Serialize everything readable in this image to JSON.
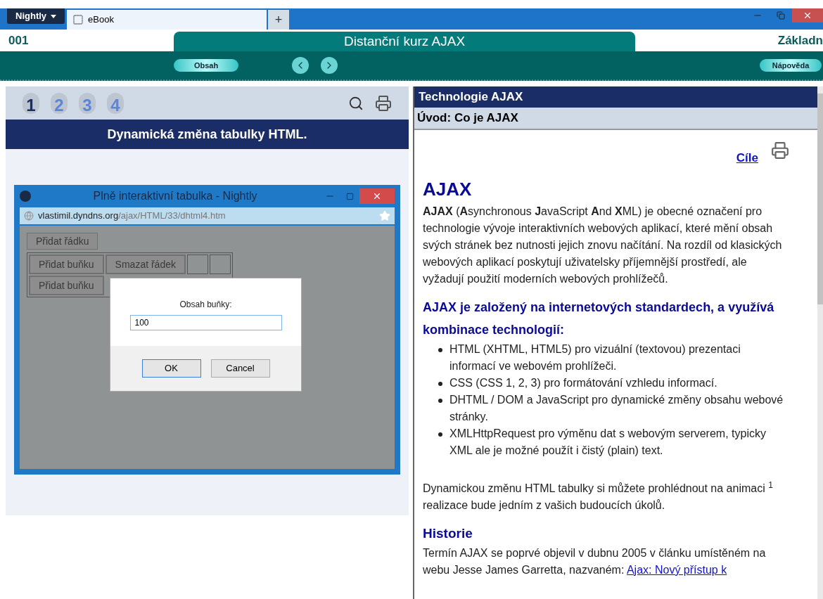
{
  "browser": {
    "menu_button": "Nightly",
    "tabs": [
      {
        "label": "eBook",
        "selected": true
      }
    ],
    "new_tab": "+"
  },
  "header": {
    "page_code": "001",
    "course_title": "Distanční kurz AJAX",
    "right_label": "Základn"
  },
  "toolbar": {
    "contents_button": "Obsah",
    "help_button": "Nápověda"
  },
  "left": {
    "pages": [
      {
        "label": "1",
        "selected": true
      },
      {
        "label": "2",
        "selected": false
      },
      {
        "label": "3",
        "selected": false
      },
      {
        "label": "4",
        "selected": false
      }
    ],
    "title": "Dynamická změna tabulky HTML.",
    "inner_window": {
      "title": "Plně interaktivní tabulka - Nightly",
      "url_host": "vlastimil.dyndns.org",
      "url_path": "/ajax/HTML/33/dhtml4.htm",
      "add_row_button": "Přidat řádku",
      "rows": [
        {
          "cells": [
            {
              "kind": "button",
              "label": "Přidat buňku"
            },
            {
              "kind": "button",
              "label": "Smazat řádek"
            },
            {
              "kind": "empty"
            },
            {
              "kind": "empty"
            }
          ]
        },
        {
          "cells": [
            {
              "kind": "button",
              "label": "Přidat buňku"
            }
          ]
        }
      ],
      "dialog": {
        "label": "Obsah buňky:",
        "value": "100",
        "buttons": [
          {
            "label": "OK",
            "focused": true
          },
          {
            "label": "Cancel",
            "focused": false
          }
        ]
      }
    }
  },
  "right": {
    "section_title": "Technologie AJAX",
    "subsection_title": "Úvod: Co je AJAX",
    "goals_link": "Cíle",
    "heading": "AJAX",
    "intro": "**AJAX** (**A**synchronous **J**avaScript **A**nd **X**ML) je obecné označení pro technologie vývoje interaktivních webových aplikací, které mění obsah svých stránek bez nutnosti jejich znovu načítání. Na rozdíl od klasických webových aplikací poskytují uživatelsky příjemnější prostředí, ale vyžadují použití moderních webových prohlížečů.",
    "subheading": "AJAX je založený na internetových standardech, a využívá kombinace technologií:",
    "bullets": [
      "HTML (XHTML, HTML5) pro vizuální (textovou) prezentaci informací ve webovém prohlížeči.",
      "CSS (CSS 1, 2, 3) pro formátování vzhledu informací.",
      "DHTML / DOM a JavaScript pro dynamické změny obsahu webové stránky.",
      "XMLHttpRequest pro výměnu dat s webovým serverem, typicky XML ale je možné použít i čistý (plain) text."
    ],
    "animation_text": "Dynamickou změnu HTML tabulky si můžete prohlédnout na animaci $^{1}$ realizace bude jedním z vašich budoucích úkolů.",
    "history_heading": "Historie",
    "history_text": "Termín AJAX se poprvé objevil v dubnu 2005 v článku umístěném na webu Jesse James Garretta, nazvaném:",
    "history_link": "Ajax: Nový přístup k"
  }
}
